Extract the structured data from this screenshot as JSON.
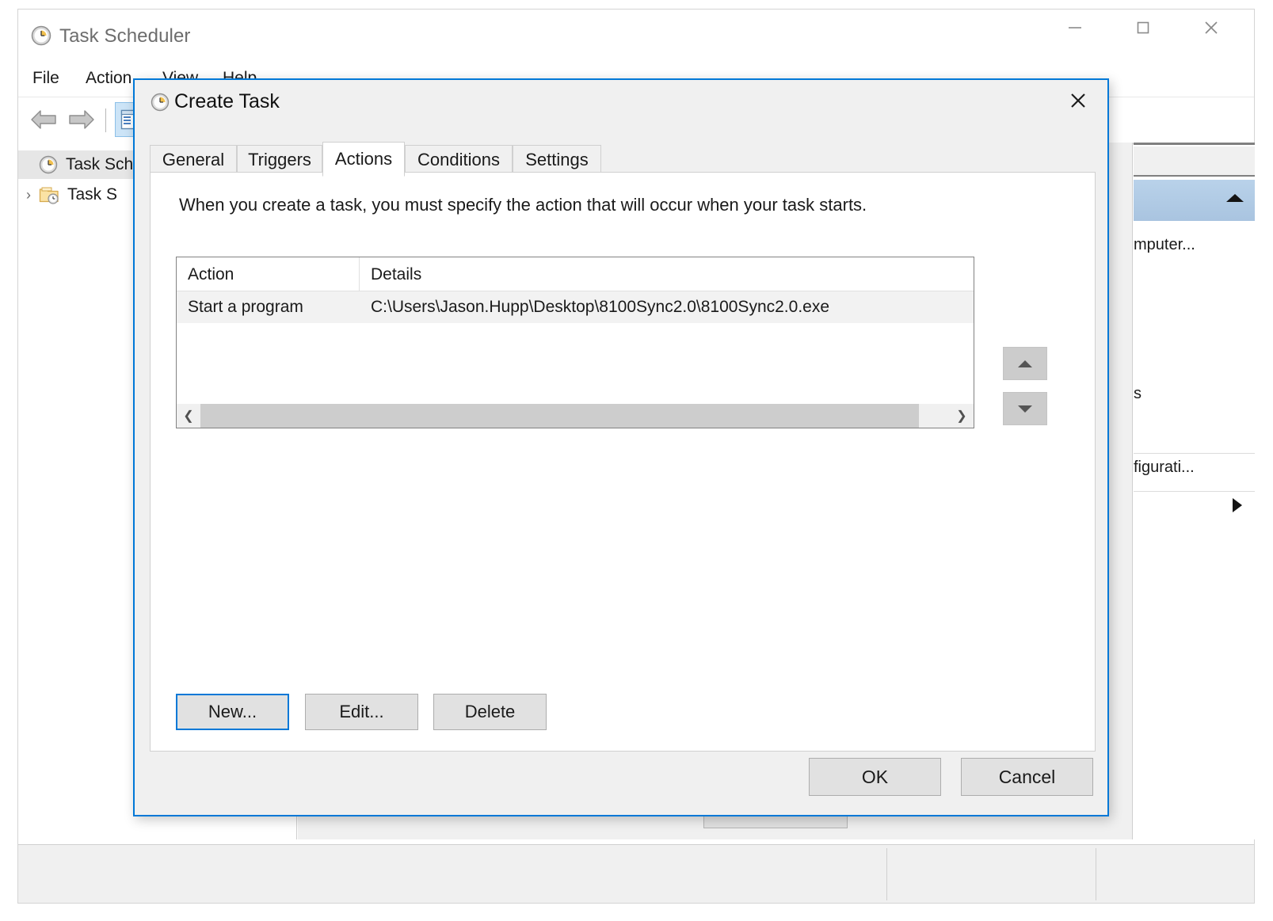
{
  "main_window": {
    "title": "Task Scheduler",
    "title_icon": "clock-icon",
    "window_controls": {
      "minimize": "minimize-icon",
      "maximize": "maximize-icon",
      "close": "close-icon"
    },
    "menu": [
      {
        "label": "File"
      },
      {
        "label": "Action"
      },
      {
        "label": "View"
      },
      {
        "label": "Help"
      }
    ],
    "toolbar": {
      "back": "back-arrow-icon",
      "forward": "forward-arrow-icon",
      "show_hide_console_tree": "console-tree-icon"
    },
    "tree": [
      {
        "label": "Task Sche",
        "icon": "clock-icon",
        "selected": true,
        "expander": ""
      },
      {
        "label": "Task S",
        "icon": "task-folder-icon",
        "selected": false,
        "expander": "›"
      }
    ],
    "actions_pane": {
      "collapse_icon": "collapse-triangle-icon",
      "items": [
        {
          "label": "mputer..."
        },
        {
          "label": "s"
        },
        {
          "label": "figurati..."
        },
        {
          "label": ""
        }
      ],
      "submenu_arrow": "submenu-arrow-icon"
    }
  },
  "dialog": {
    "title": "Create Task",
    "title_icon": "clock-icon",
    "close": "close-icon",
    "tabs": [
      {
        "label": "General",
        "active": false
      },
      {
        "label": "Triggers",
        "active": false
      },
      {
        "label": "Actions",
        "active": true
      },
      {
        "label": "Conditions",
        "active": false
      },
      {
        "label": "Settings",
        "active": false
      }
    ],
    "instruction": "When you create a task, you must specify the action that will occur when your task starts.",
    "list": {
      "columns": [
        "Action",
        "Details"
      ],
      "rows": [
        {
          "action": "Start a program",
          "details": "C:\\Users\\Jason.Hupp\\Desktop\\8100Sync2.0\\8100Sync2.0.exe",
          "selected": true
        }
      ],
      "hscrollbar": {
        "left_arrow": "chevron-left-icon",
        "right_arrow": "chevron-right-icon"
      }
    },
    "move_buttons": {
      "up": "move-up-icon",
      "down": "move-down-icon"
    },
    "action_buttons": [
      {
        "label": "New...",
        "focused": true
      },
      {
        "label": "Edit...",
        "focused": false
      },
      {
        "label": "Delete",
        "focused": false
      }
    ],
    "footer_buttons": [
      {
        "label": "OK"
      },
      {
        "label": "Cancel"
      }
    ]
  },
  "colors": {
    "accent": "#0078d7",
    "dialog_bg": "#f0f0f0",
    "selected_row": "#f2f2f2",
    "actions_header": "#a9c4e0"
  }
}
